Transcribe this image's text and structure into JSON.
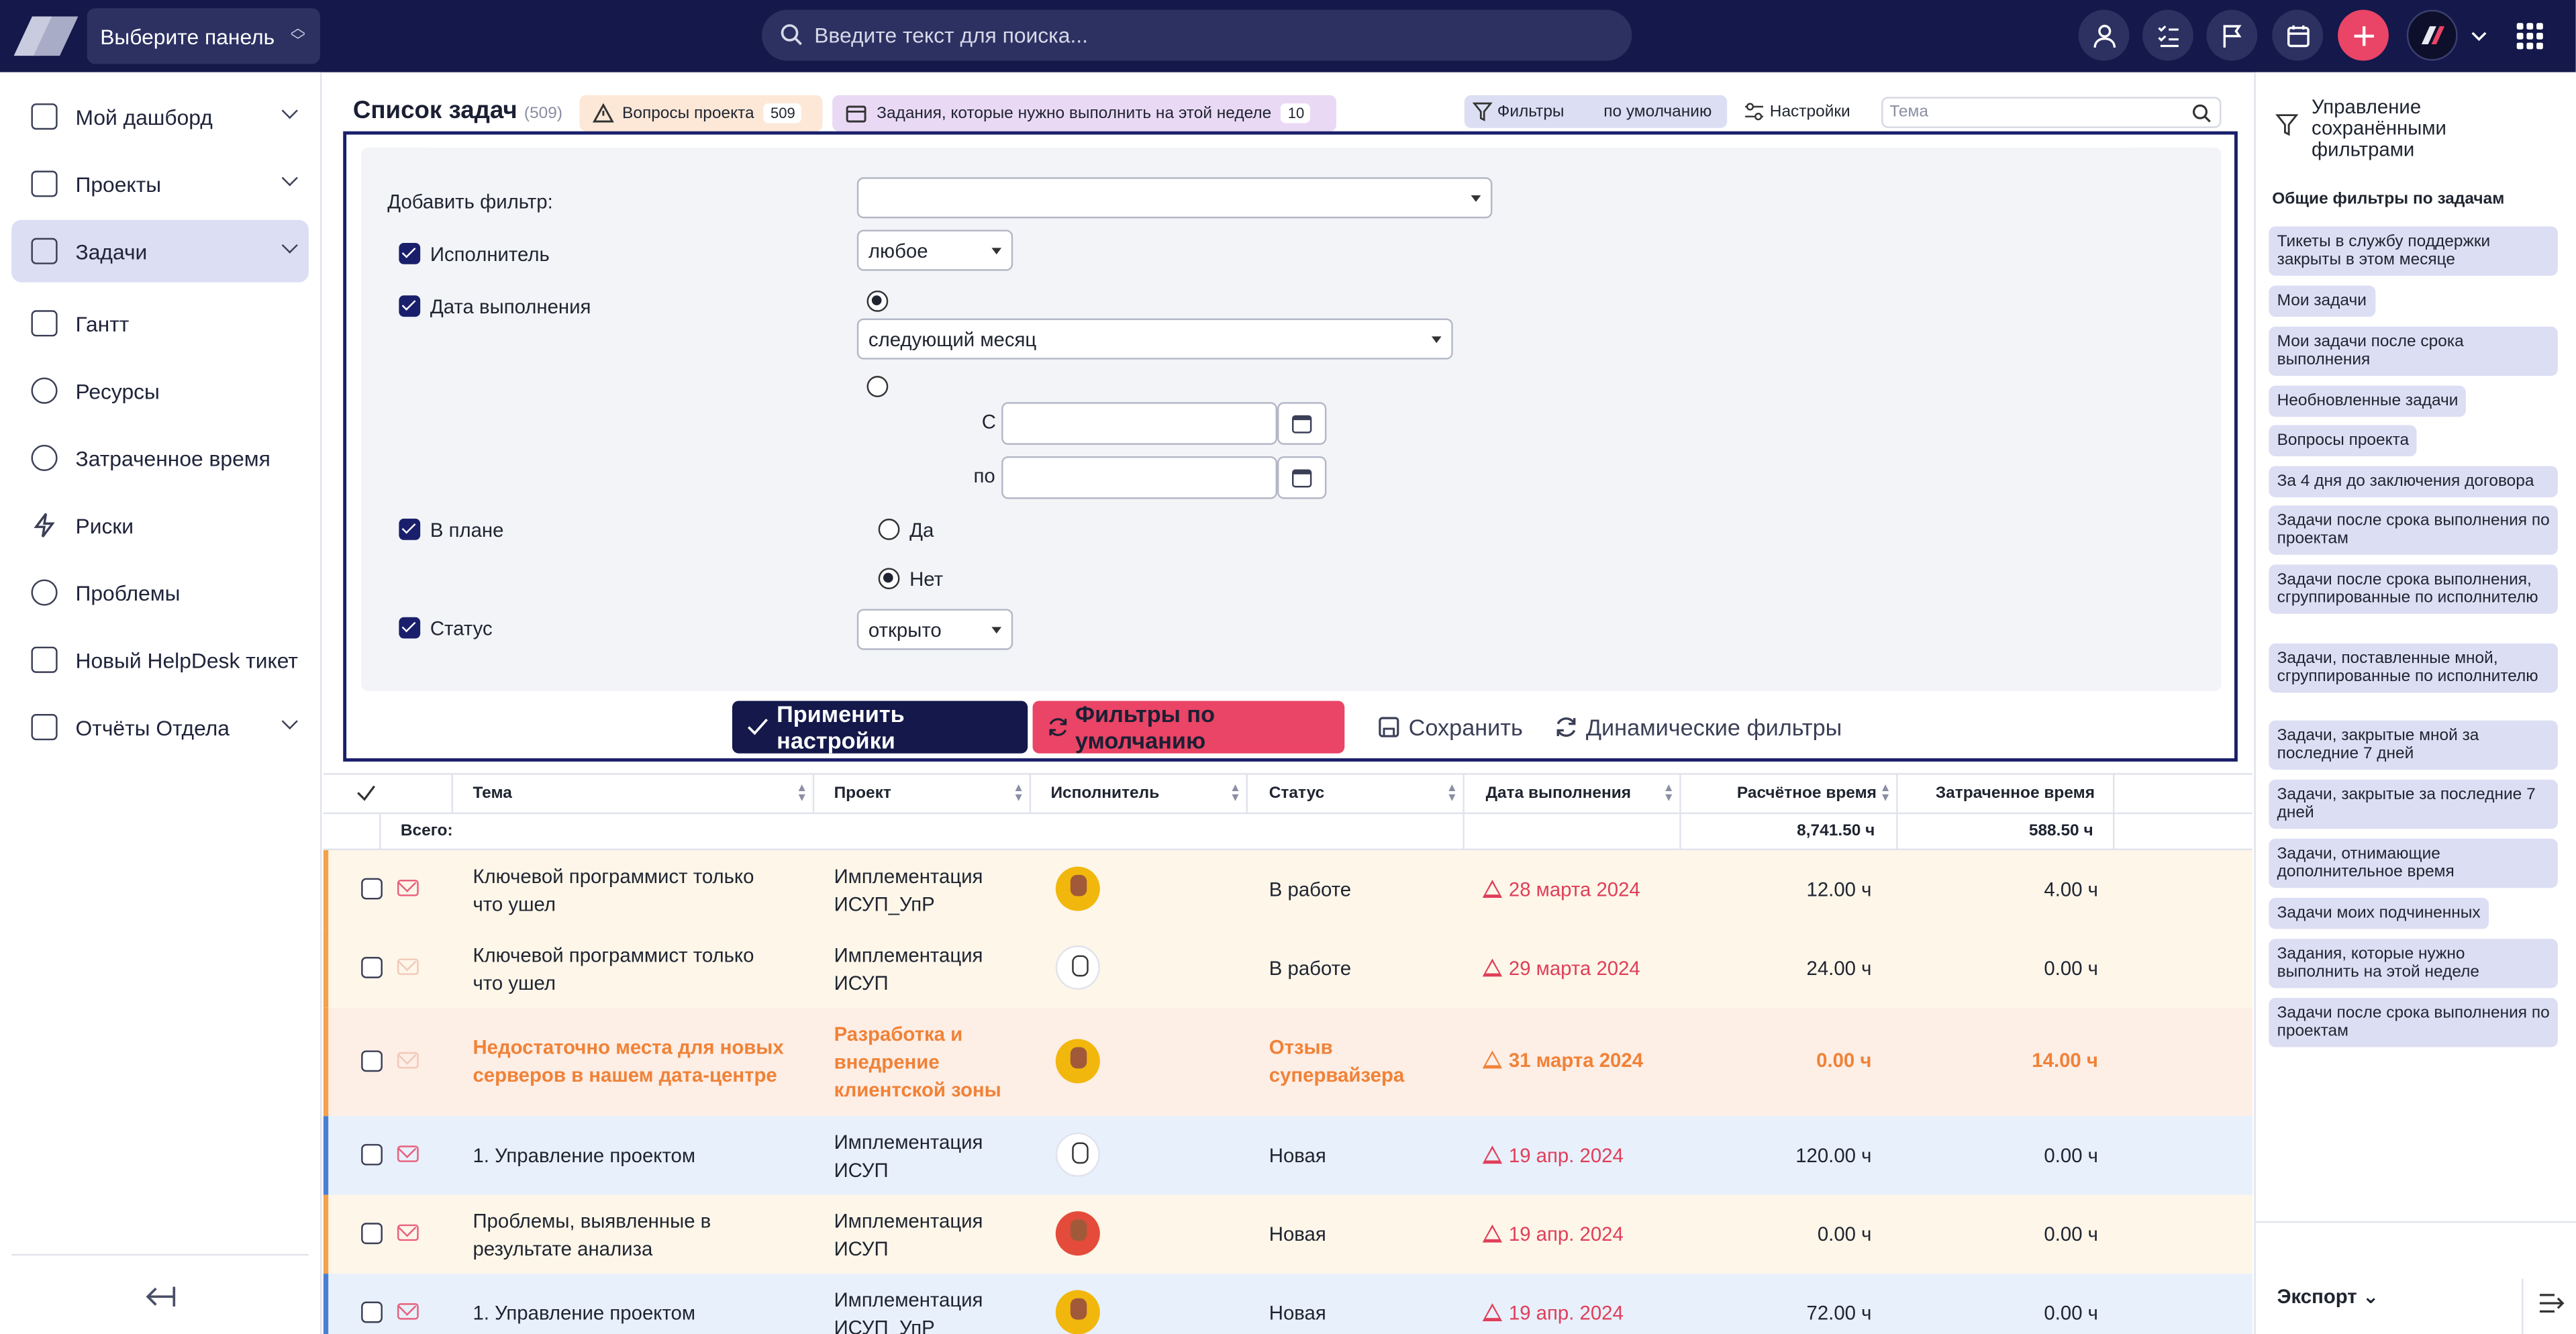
{
  "topbar": {
    "panel_select": "Выберите панель",
    "search_placeholder": "Введите текст для поиска..."
  },
  "sidebar": {
    "items": [
      {
        "label": "Мой дашборд"
      },
      {
        "label": "Проекты"
      },
      {
        "label": "Задачи"
      },
      {
        "label": "Гантт"
      },
      {
        "label": "Ресурсы"
      },
      {
        "label": "Затраченное время"
      },
      {
        "label": "Риски"
      },
      {
        "label": "Проблемы"
      },
      {
        "label": "Новый HelpDesk тикет"
      },
      {
        "label": "Отчёты Отдела"
      }
    ]
  },
  "header": {
    "title": "Список задач",
    "count": "(509)",
    "chip_a_label": "Вопросы проекта",
    "chip_a_count": "509",
    "chip_b_label": "Задания, которые нужно выполнить на этой неделе",
    "chip_b_count": "10",
    "filters_label": "Фильтры",
    "filters_default": "по умолчанию",
    "settings_label": "Настройки",
    "subject_placeholder": "Тема"
  },
  "filters": {
    "add_filter_label": "Добавить фильтр:",
    "assignee_label": "Исполнитель",
    "assignee_value": "любое",
    "due_label": "Дата выполнения",
    "due_period": "следующий месяц",
    "from_label": "С",
    "to_label": "по",
    "in_plan_label": "В плане",
    "yes_label": "Да",
    "no_label": "Нет",
    "status_label": "Статус",
    "status_value": "открыто",
    "apply_button": "Применить настройки",
    "default_button": "Фильтры по умолчанию",
    "save_button": "Сохранить",
    "dynamic_button": "Динамические фильтры"
  },
  "table": {
    "columns": [
      "Тема",
      "Проект",
      "Исполнитель",
      "Статус",
      "Дата выполнения",
      "Расчётное время",
      "Затраченное время"
    ],
    "total_label": "Всего:",
    "total_estimated": "8,741.50 ч",
    "total_spent": "588.50 ч",
    "rows": [
      {
        "subject1": "Ключевой программист только",
        "subject2": "что ушел",
        "project1": "Имплементация",
        "project2": "ИСУП_УпР",
        "project3": "",
        "status1": "В работе",
        "status2": "",
        "due": "28 марта 2024",
        "estimated": "12.00 ч",
        "spent": "4.00 ч"
      },
      {
        "subject1": "Ключевой программист только",
        "subject2": "что ушел",
        "project1": "Имплементация",
        "project2": "ИСУП",
        "project3": "",
        "status1": "В работе",
        "status2": "",
        "due": "29 марта 2024",
        "estimated": "24.00 ч",
        "spent": "0.00 ч"
      },
      {
        "subject1": "Недостаточно места для новых",
        "subject2": "серверов в нашем дата-центре",
        "project1": "Разработка и",
        "project2": "внедрение",
        "project3": "клиентской зоны",
        "status1": "Отзыв",
        "status2": "супервайзера",
        "due": "31 марта 2024",
        "estimated": "0.00 ч",
        "spent": "14.00 ч"
      },
      {
        "subject1": "1. Управление проектом",
        "subject2": "",
        "project1": "Имплементация",
        "project2": "ИСУП",
        "project3": "",
        "status1": "Новая",
        "status2": "",
        "due": "19 апр. 2024",
        "estimated": "120.00 ч",
        "spent": "0.00 ч"
      },
      {
        "subject1": "Проблемы, выявленные в",
        "subject2": "результате анализа",
        "project1": "Имплементация",
        "project2": "ИСУП",
        "project3": "",
        "status1": "Новая",
        "status2": "",
        "due": "19 апр. 2024",
        "estimated": "0.00 ч",
        "spent": "0.00 ч"
      },
      {
        "subject1": "1. Управление проектом",
        "subject2": "",
        "project1": "Имплементация",
        "project2": "ИСУП_УпР",
        "project3": "",
        "status1": "Новая",
        "status2": "",
        "due": "19 апр. 2024",
        "estimated": "72.00 ч",
        "spent": "0.00 ч"
      }
    ]
  },
  "right_panel": {
    "title_line1": "Управление",
    "title_line2": "сохранёнными",
    "title_line3": "фильтрами",
    "subtitle": "Общие фильтры по задачам",
    "filters": [
      "Тикеты в службу поддержки закрыты в этом месяце",
      "Мои задачи",
      "Мои задачи после срока выполнения",
      "Необновленные задачи",
      "Вопросы проекта",
      "За 4 дня до заключения договора",
      "Задачи после срока выполнения по проектам",
      "Задачи после срока выполнения, сгруппированные по исполнителю",
      "Задачи, поставленные мной, сгруппированные по исполнителю",
      "Задачи, закрытые мной за последние 7 дней",
      "Задачи, закрытые за последние 7 дней",
      "Задачи, отнимающие дополнительное время",
      "Задачи моих подчиненных",
      "Задания, которые нужно выполнить на этой неделе",
      "Задачи после срока выполнения по проектам"
    ],
    "export_label": "Экспорт"
  },
  "colors": {
    "navy": "#14184a",
    "accent_pink": "#ea4466",
    "active_bg": "#dcdef3",
    "overdue_red": "#e03e59",
    "row_orange": "#fdf6e9",
    "row_blue": "#e8f0fb"
  }
}
